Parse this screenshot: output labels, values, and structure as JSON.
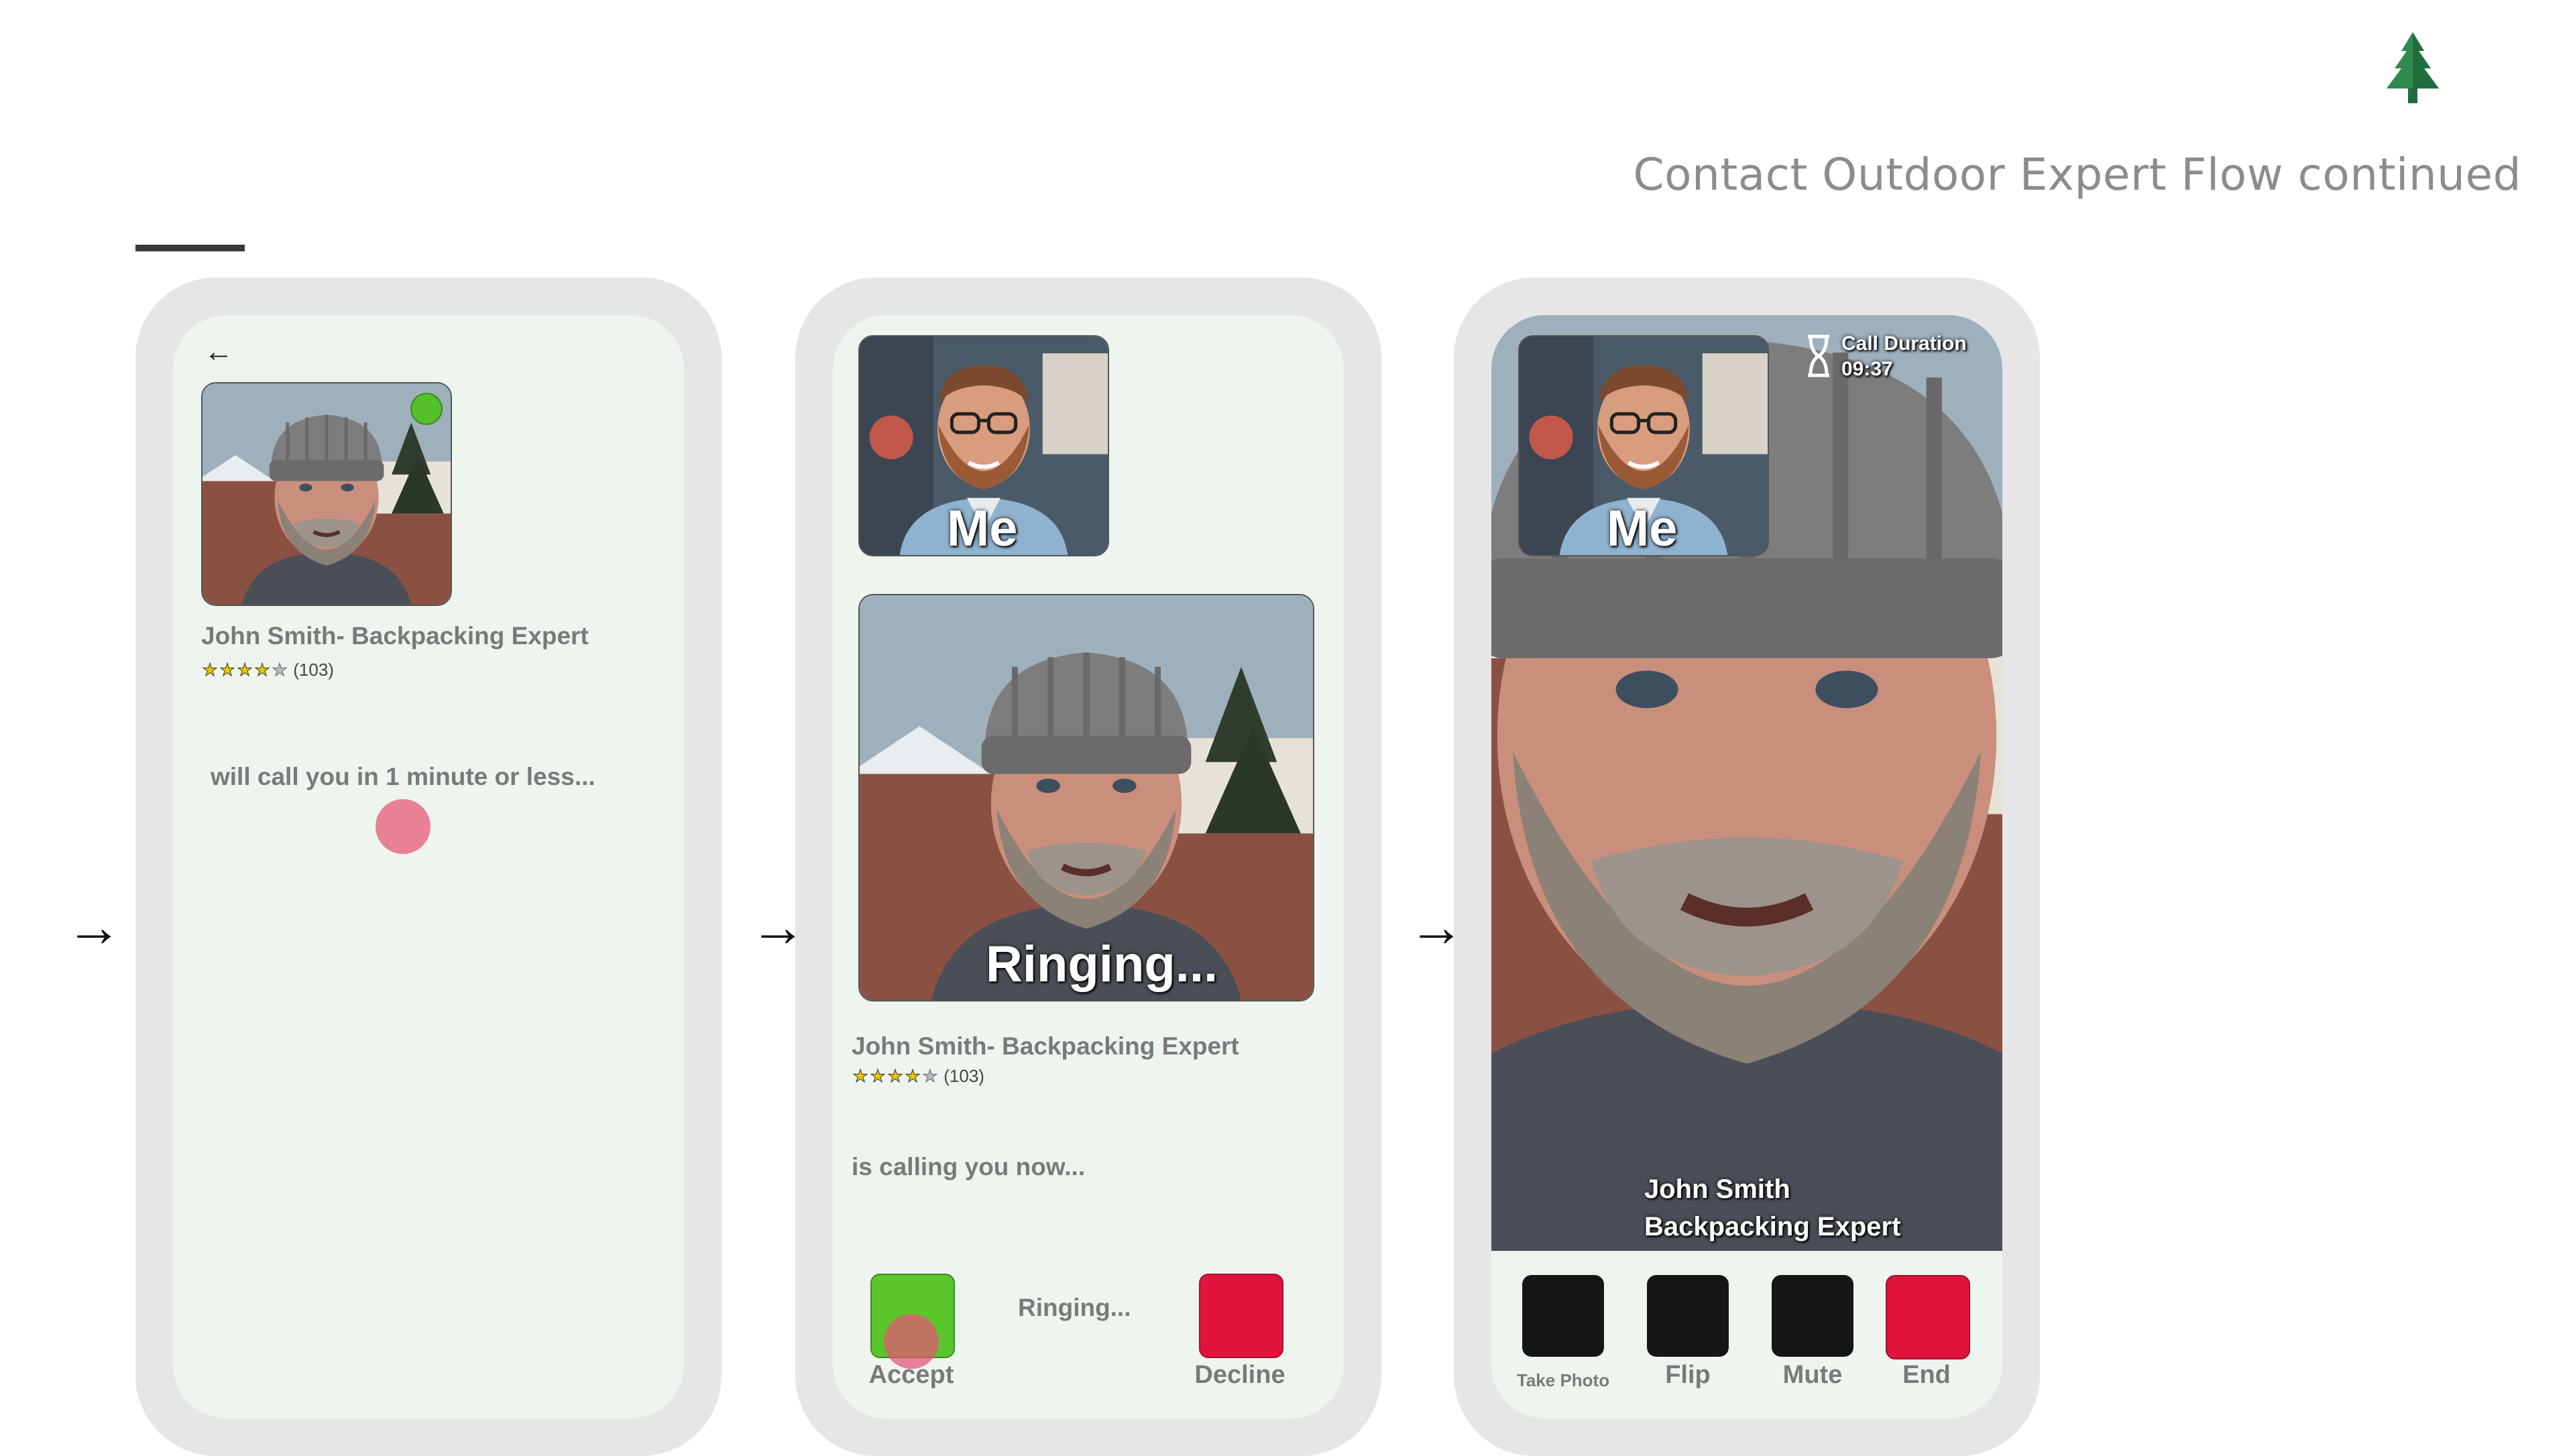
{
  "header": {
    "title": "Contact Outdoor Expert Flow continued",
    "logo_icon": "pine-tree-icon"
  },
  "colors": {
    "online": "#55c02a",
    "accept": "#5ac62c",
    "decline": "#e0143c",
    "dark_button": "#161616",
    "screen_bg": "#eef5ee",
    "phone_frame": "#e6e6e6",
    "touch_indicator": "#e75474"
  },
  "flow_arrows": [
    "→",
    "→",
    "→"
  ],
  "screen1": {
    "back_icon": "back-arrow-icon",
    "expert_name": "John Smith- Backpacking Expert",
    "rating": {
      "stars": 4,
      "max": 5,
      "count_label": "(103)"
    },
    "status_message": "will call you in 1 minute or less..."
  },
  "screen2": {
    "self_label": "Me",
    "ringing_overlay": "Ringing...",
    "expert_name": "John Smith- Backpacking Expert",
    "rating": {
      "stars": 4,
      "max": 5,
      "count_label": "(103)"
    },
    "status_message": "is calling you now...",
    "center_status": "Ringing...",
    "accept_label": "Accept",
    "decline_label": "Decline"
  },
  "screen3": {
    "self_label": "Me",
    "timer_icon": "hourglass-icon",
    "call_duration_label": "Call Duration",
    "call_duration_value": "09:37",
    "caller_name": "John Smith",
    "caller_title": "Backpacking Expert",
    "controls": [
      {
        "label": "Take Photo"
      },
      {
        "label": "Flip"
      },
      {
        "label": "Mute"
      },
      {
        "label": "End"
      }
    ]
  }
}
